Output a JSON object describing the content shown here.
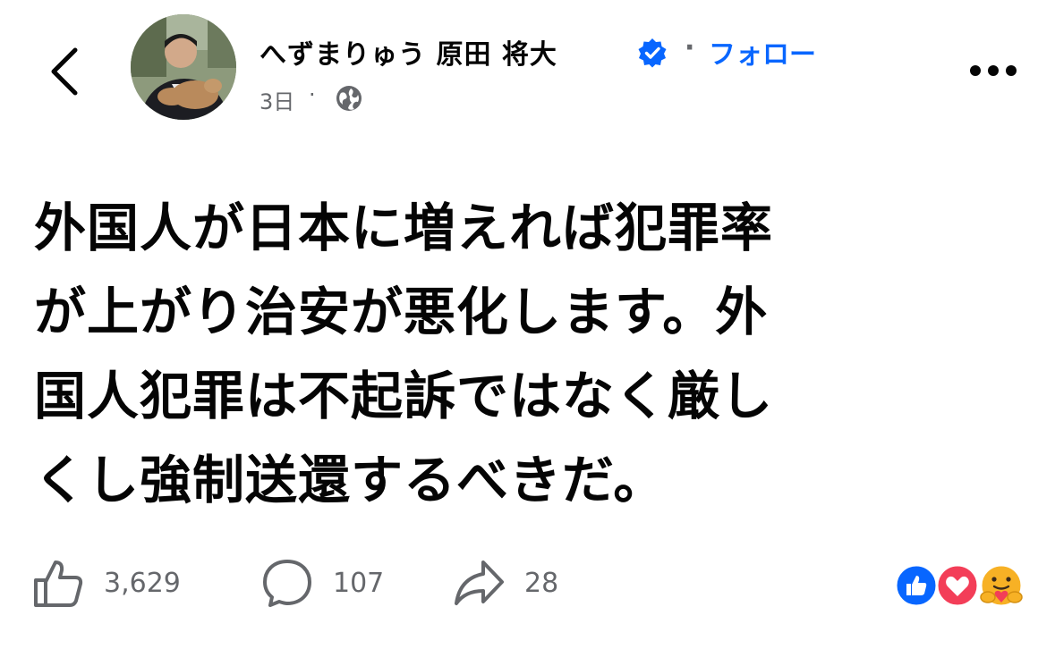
{
  "post": {
    "author": {
      "name": "へずまりゅう 原田 将大",
      "verified": true,
      "follow_label": "フォロー"
    },
    "meta": {
      "time": "3日",
      "separator": "·",
      "audience_icon": "globe-icon"
    },
    "text": "外国人が日本に増えれば犯罪率\nが上がり治安が悪化します。外\n国人犯罪は不起訴ではなく厳し\nくし強制送還するべきだ。",
    "stats": {
      "likes": "3,629",
      "comments": "107",
      "shares": "28"
    },
    "reactions": [
      "like-icon",
      "love-icon",
      "care-icon"
    ]
  },
  "header": {
    "back_icon": "chevron-left-icon",
    "more_icon": "more-horizontal-icon",
    "separator": "·"
  },
  "colors": {
    "accent": "#0866ff",
    "secondary_text": "#65676b",
    "primary_text": "#050505",
    "love": "#f33e58",
    "care": "#f7b125"
  }
}
